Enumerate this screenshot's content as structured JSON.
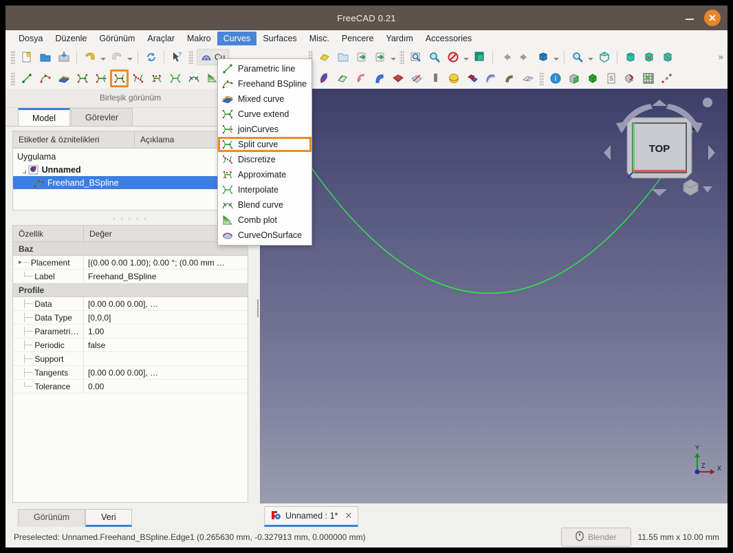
{
  "window": {
    "title": "FreeCAD 0.21",
    "minimize_label": "–",
    "close_label": "✕"
  },
  "menubar": {
    "items": [
      {
        "label": "Dosya",
        "mnemonic": "D",
        "active": false
      },
      {
        "label": "Düzenle",
        "mnemonic": "z",
        "active": false
      },
      {
        "label": "Görünüm",
        "mnemonic": "r",
        "active": false
      },
      {
        "label": "Araçlar",
        "mnemonic": "",
        "active": false
      },
      {
        "label": "Makro",
        "mnemonic": "M",
        "active": false
      },
      {
        "label": "Curves",
        "mnemonic": "",
        "active": true
      },
      {
        "label": "Surfaces",
        "mnemonic": "",
        "active": false
      },
      {
        "label": "Misc.",
        "mnemonic": "",
        "active": false
      },
      {
        "label": "Pencere",
        "mnemonic": "P",
        "active": false
      },
      {
        "label": "Yardım",
        "mnemonic": "Y",
        "active": false
      },
      {
        "label": "Accessories",
        "mnemonic": "",
        "active": false
      }
    ]
  },
  "curves_menu": {
    "highlighted": "Split curve",
    "items": [
      {
        "label": "Parametric line",
        "icon": "parametric-line-icon"
      },
      {
        "label": "Freehand BSpline",
        "icon": "freehand-bspline-icon"
      },
      {
        "label": "Mixed curve",
        "icon": "mixed-curve-icon"
      },
      {
        "label": "Curve extend",
        "icon": "curve-extend-icon"
      },
      {
        "label": "joinCurves",
        "icon": "join-curves-icon"
      },
      {
        "label": "Split curve",
        "icon": "split-curve-icon"
      },
      {
        "label": "Discretize",
        "icon": "discretize-icon"
      },
      {
        "label": "Approximate",
        "icon": "approximate-icon"
      },
      {
        "label": "Interpolate",
        "icon": "interpolate-icon"
      },
      {
        "label": "Blend curve",
        "icon": "blend-curve-icon"
      },
      {
        "label": "Comb plot",
        "icon": "comb-plot-icon"
      },
      {
        "label": "CurveOnSurface",
        "icon": "curve-on-surface-icon"
      }
    ]
  },
  "toolbar": {
    "workbench_selector": "Cu",
    "overflow_label": "»",
    "highlighted_tool": "split-curve-tool"
  },
  "panel": {
    "combo_view_title": "Birleşik görünüm",
    "tabs": [
      {
        "label": "Model",
        "selected": true
      },
      {
        "label": "Görevler",
        "selected": false
      }
    ],
    "tree": {
      "headers": [
        "Etiketler & öznitelikleri",
        "Açıklama"
      ],
      "rows": [
        {
          "label": "Uygulama",
          "level": 1,
          "selected": false,
          "icon": ""
        },
        {
          "label": "Unnamed",
          "level": 2,
          "selected": false,
          "icon": "document-icon"
        },
        {
          "label": "Freehand_BSpline",
          "level": 3,
          "selected": true,
          "icon": "bspline-icon"
        }
      ]
    },
    "splitter_dots": "- - - - -",
    "properties": {
      "headers": [
        "Özellik",
        "Değer"
      ],
      "groups": [
        {
          "name": "Baz",
          "rows": [
            {
              "key": "Placement",
              "value": "[(0.00 0.00 1.00); 0.00 °; (0.00 mm …",
              "expandable": true
            },
            {
              "key": "Label",
              "value": "Freehand_BSpline",
              "expandable": false
            }
          ]
        },
        {
          "name": "Profile",
          "rows": [
            {
              "key": "Data",
              "value": "[0.00 0.00 0.00], …",
              "expandable": false
            },
            {
              "key": "Data Type",
              "value": "[0,0,0]",
              "expandable": false
            },
            {
              "key": "Parametri…",
              "value": "1.00",
              "expandable": false
            },
            {
              "key": "Periodic",
              "value": "false",
              "expandable": false
            },
            {
              "key": "Support",
              "value": "",
              "expandable": false
            },
            {
              "key": "Tangents",
              "value": "[0.00 0.00 0.00], …",
              "expandable": false
            },
            {
              "key": "Tolerance",
              "value": "0.00",
              "expandable": false
            }
          ]
        }
      ]
    },
    "bottom_tabs": [
      {
        "label": "Görünüm",
        "selected": false
      },
      {
        "label": "Veri",
        "selected": true
      }
    ]
  },
  "viewport": {
    "nav_cube_face": "TOP",
    "axes": {
      "x": "X",
      "y": "Y",
      "z": "Z"
    },
    "curve_color": "#2fe04a",
    "background_top": "#3e3e69",
    "background_bottom": "#9a9cb0"
  },
  "document_tab": {
    "label": "Unnamed : 1*",
    "close_label": "✕"
  },
  "statusbar": {
    "message": "Preselected: Unnamed.Freehand_BSpline.Edge1 (0.265630 mm, -0.327913 mm, 0.000000 mm)",
    "nav_style": "Blender",
    "dimensions": "11.55 mm x 10.00 mm"
  }
}
